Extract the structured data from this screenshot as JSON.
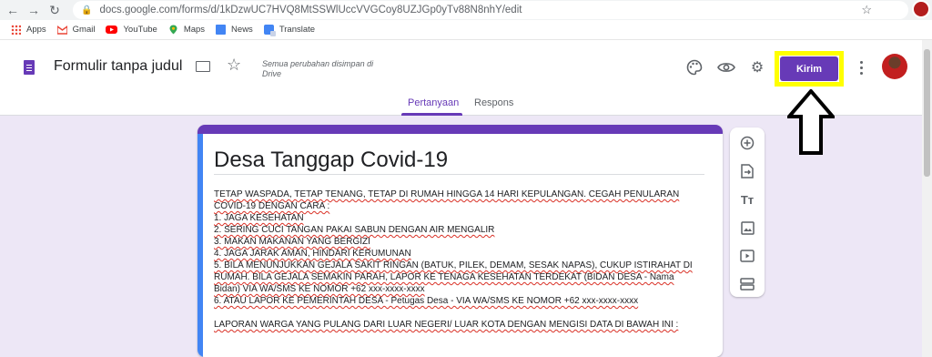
{
  "browser": {
    "url": "docs.google.com/forms/d/1kDzwUC7HVQ8MtSSWlUccVVGCoy8UZJGp0yTv88N8nhY/edit"
  },
  "bookmarks": [
    {
      "label": "Apps",
      "icon": "apps-grid-icon"
    },
    {
      "label": "Gmail",
      "icon": "gmail-icon"
    },
    {
      "label": "YouTube",
      "icon": "youtube-icon"
    },
    {
      "label": "Maps",
      "icon": "maps-icon"
    },
    {
      "label": "News",
      "icon": "news-icon"
    },
    {
      "label": "Translate",
      "icon": "translate-icon"
    }
  ],
  "app": {
    "title": "Formulir tanpa judul",
    "save_status": "Semua perubahan disimpan di Drive",
    "send_label": "Kirim",
    "accent": "#673ab7",
    "highlight": "#ffff00"
  },
  "tabs": {
    "questions": "Pertanyaan",
    "responses": "Respons"
  },
  "form": {
    "title": "Desa Tanggap Covid-19",
    "description_lines": [
      "TETAP WASPADA, TETAP TENANG, TETAP DI RUMAH HINGGA 14 HARI KEPULANGAN. CEGAH PENULARAN",
      "COVID-19 DENGAN CARA :",
      "1. JAGA KESEHATAN",
      "2. SERING CUCI TANGAN PAKAI SABUN DENGAN AIR MENGALIR",
      "3. MAKAN MAKANAN YANG BERGIZI",
      "4. JAGA JARAK AMAN, HINDARI KERUMUNAN",
      "5. BILA MENUNJUKKAN GEJALA SAKIT RINGAN (BATUK, PILEK, DEMAM, SESAK NAPAS), CUKUP ISTIRAHAT DI",
      "RUMAH. BILA GEJALA SEMAKIN PARAH, LAPOR KE TENAGA KESEHATAN TERDEKAT (BIDAN DESA - Nama",
      "Bidan) VIA WA/SMS KE NOMOR +62 xxx-xxxx-xxxx",
      "6. ATAU LAPOR KE PEMERINTAH DESA - Petugas Desa - VIA WA/SMS KE NOMOR +62 xxx-xxxx-xxxx",
      "",
      "LAPORAN WARGA YANG PULANG DARI LUAR NEGERI/ LUAR KOTA DENGAN MENGISI DATA DI BAWAH INI :"
    ]
  }
}
